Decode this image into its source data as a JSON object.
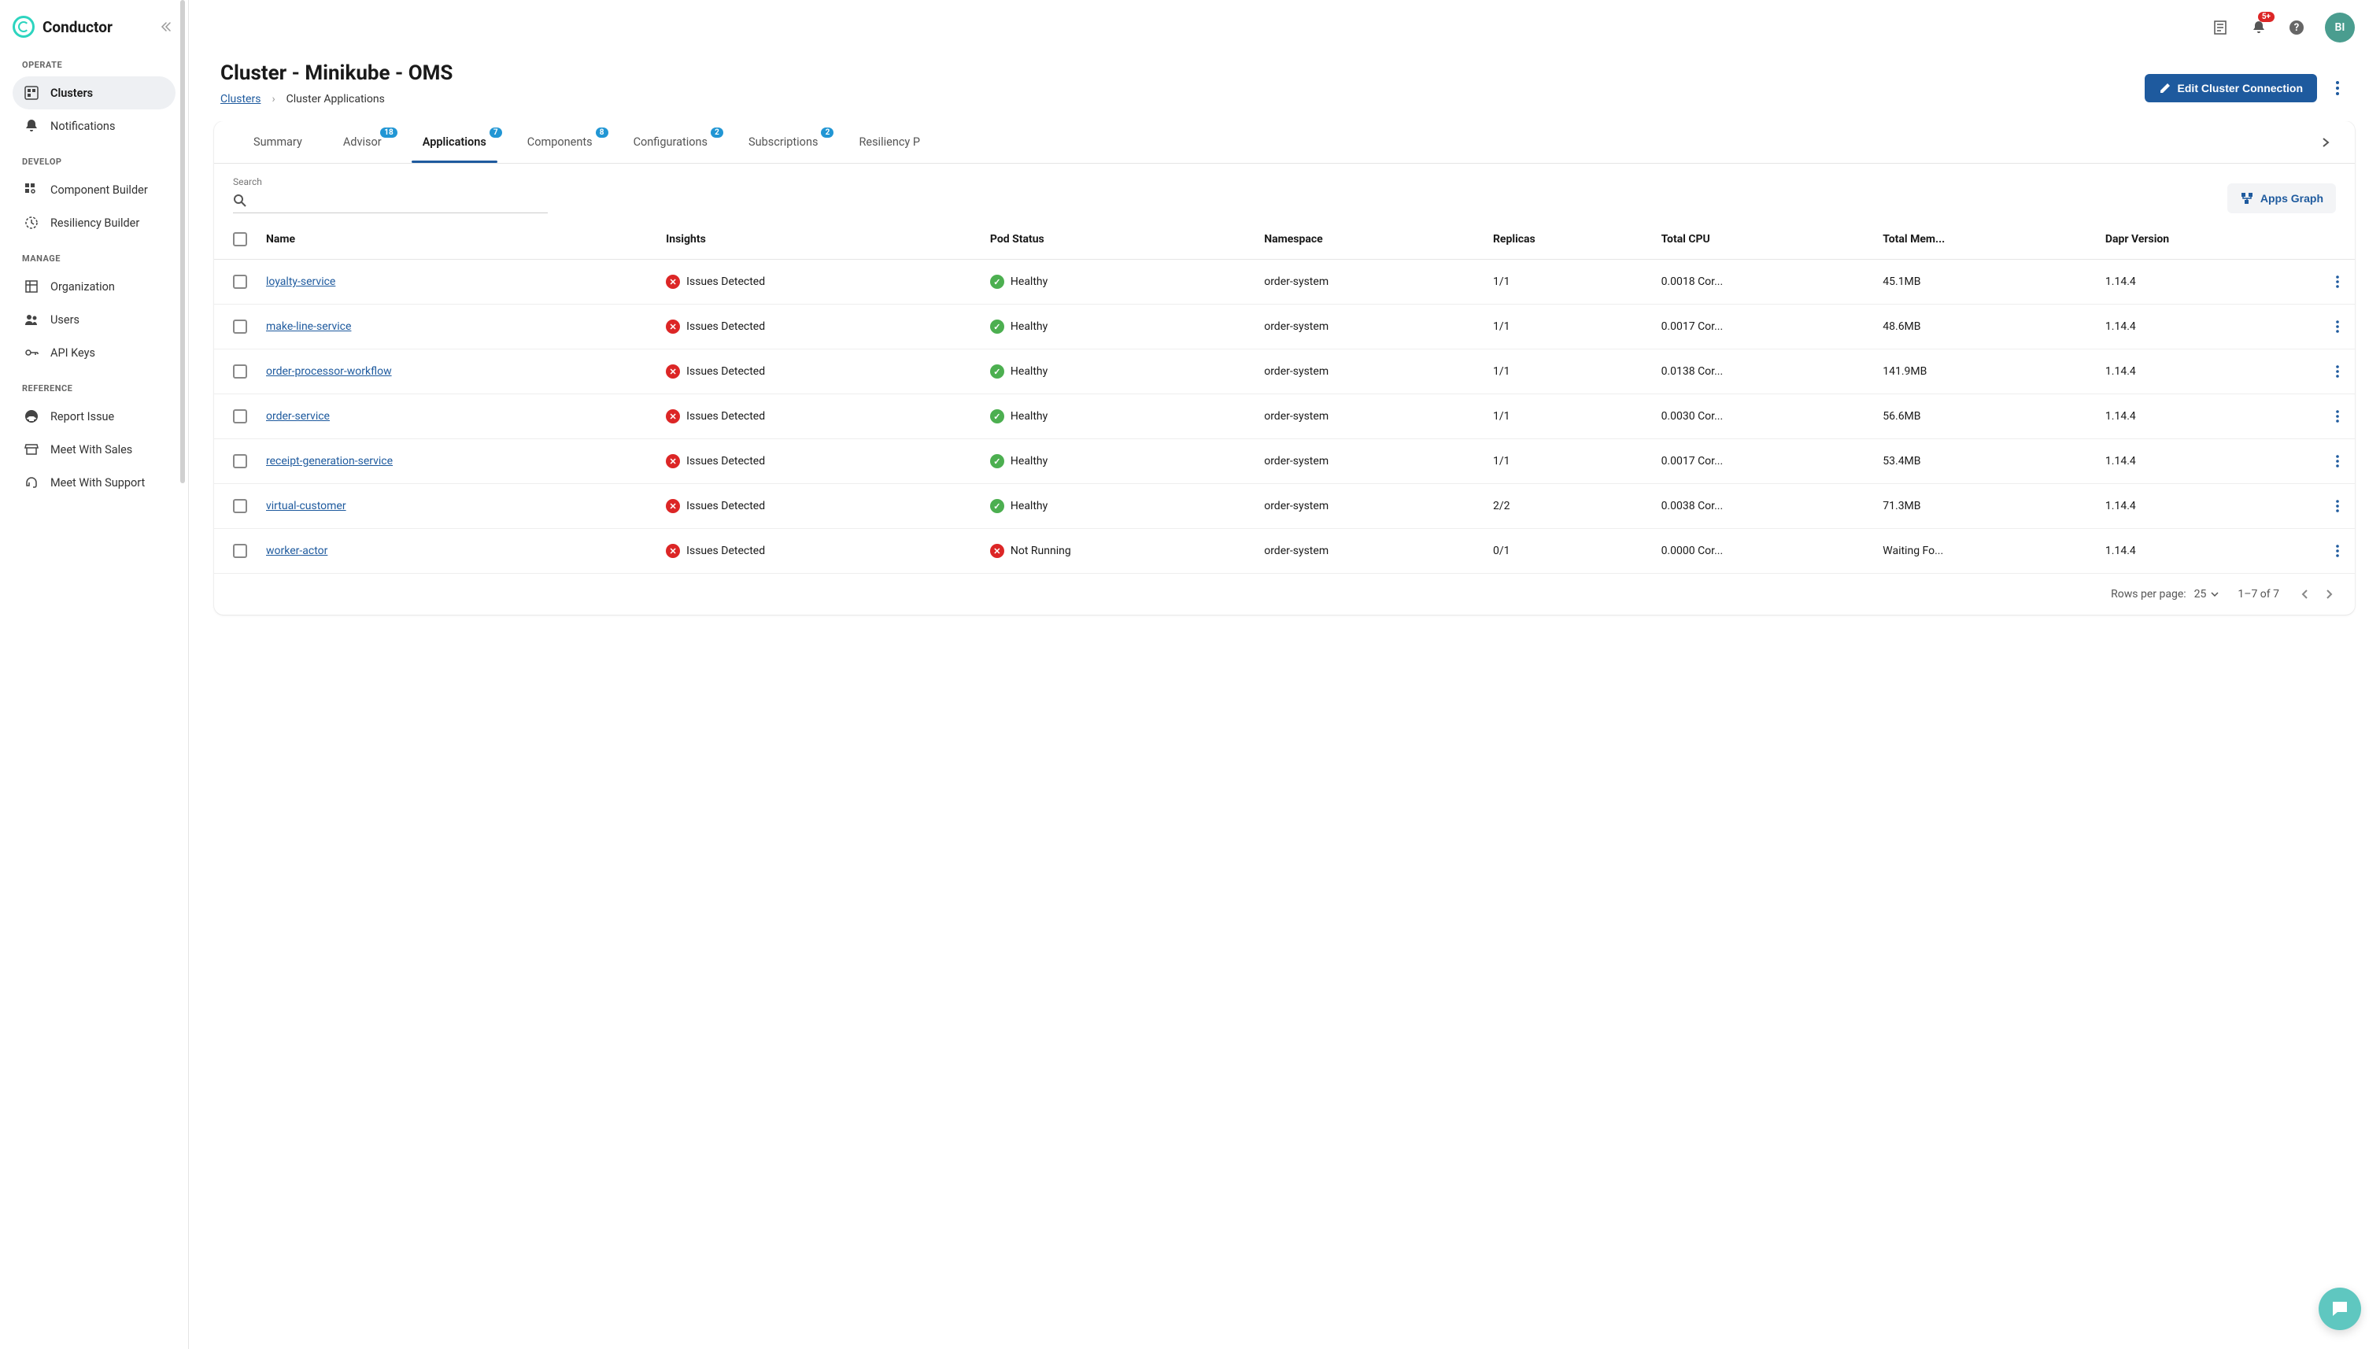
{
  "brand": {
    "name": "Conductor"
  },
  "topbar": {
    "notifications_badge": "5+",
    "avatar_initials": "BI"
  },
  "sidebar": {
    "sections": {
      "operate": "OPERATE",
      "develop": "DEVELOP",
      "manage": "MANAGE",
      "reference": "REFERENCE"
    },
    "items": {
      "clusters": "Clusters",
      "notifications": "Notifications",
      "component_builder": "Component Builder",
      "resiliency_builder": "Resiliency Builder",
      "organization": "Organization",
      "users": "Users",
      "api_keys": "API Keys",
      "report_issue": "Report Issue",
      "meet_sales": "Meet With Sales",
      "meet_support": "Meet With Support"
    }
  },
  "page": {
    "title": "Cluster - Minikube - OMS",
    "breadcrumb": {
      "root": "Clusters",
      "current": "Cluster Applications"
    },
    "edit_button": "Edit Cluster Connection"
  },
  "tabs": {
    "summary": {
      "label": "Summary"
    },
    "advisor": {
      "label": "Advisor",
      "badge": "18"
    },
    "applications": {
      "label": "Applications",
      "badge": "7"
    },
    "components": {
      "label": "Components",
      "badge": "8"
    },
    "configurations": {
      "label": "Configurations",
      "badge": "2"
    },
    "subscriptions": {
      "label": "Subscriptions",
      "badge": "2"
    },
    "resiliency": {
      "label": "Resiliency P"
    }
  },
  "toolbar": {
    "search_label": "Search",
    "apps_graph": "Apps Graph"
  },
  "table": {
    "headers": {
      "name": "Name",
      "insights": "Insights",
      "pod_status": "Pod Status",
      "namespace": "Namespace",
      "replicas": "Replicas",
      "total_cpu": "Total CPU",
      "total_mem": "Total Mem...",
      "dapr_version": "Dapr Version"
    },
    "rows": [
      {
        "name": "loyalty-service",
        "insights": "Issues Detected",
        "insights_status": "error",
        "pod_status": "Healthy",
        "pod_status_type": "ok",
        "namespace": "order-system",
        "replicas": "1/1",
        "cpu": "0.0018 Cor...",
        "mem": "45.1MB",
        "version": "1.14.4"
      },
      {
        "name": "make-line-service",
        "insights": "Issues Detected",
        "insights_status": "error",
        "pod_status": "Healthy",
        "pod_status_type": "ok",
        "namespace": "order-system",
        "replicas": "1/1",
        "cpu": "0.0017 Cor...",
        "mem": "48.6MB",
        "version": "1.14.4"
      },
      {
        "name": "order-processor-workflow",
        "insights": "Issues Detected",
        "insights_status": "error",
        "pod_status": "Healthy",
        "pod_status_type": "ok",
        "namespace": "order-system",
        "replicas": "1/1",
        "cpu": "0.0138 Cor...",
        "mem": "141.9MB",
        "version": "1.14.4"
      },
      {
        "name": "order-service",
        "insights": "Issues Detected",
        "insights_status": "error",
        "pod_status": "Healthy",
        "pod_status_type": "ok",
        "namespace": "order-system",
        "replicas": "1/1",
        "cpu": "0.0030 Cor...",
        "mem": "56.6MB",
        "version": "1.14.4"
      },
      {
        "name": "receipt-generation-service",
        "insights": "Issues Detected",
        "insights_status": "error",
        "pod_status": "Healthy",
        "pod_status_type": "ok",
        "namespace": "order-system",
        "replicas": "1/1",
        "cpu": "0.0017 Cor...",
        "mem": "53.4MB",
        "version": "1.14.4"
      },
      {
        "name": "virtual-customer",
        "insights": "Issues Detected",
        "insights_status": "error",
        "pod_status": "Healthy",
        "pod_status_type": "ok",
        "namespace": "order-system",
        "replicas": "2/2",
        "cpu": "0.0038 Cor...",
        "mem": "71.3MB",
        "version": "1.14.4"
      },
      {
        "name": "worker-actor",
        "insights": "Issues Detected",
        "insights_status": "error",
        "pod_status": "Not Running",
        "pod_status_type": "error",
        "namespace": "order-system",
        "replicas": "0/1",
        "cpu": "0.0000 Cor...",
        "mem": "Waiting Fo...",
        "version": "1.14.4"
      }
    ]
  },
  "pagination": {
    "rows_label": "Rows per page:",
    "page_size": "25",
    "range": "1–7 of 7"
  }
}
